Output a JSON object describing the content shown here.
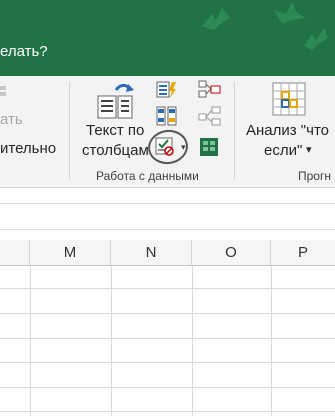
{
  "titlebar": {
    "tell_me_text": "елать?",
    "bg_color": "#217346"
  },
  "ribbon": {
    "left_partial_dim": "ать",
    "left_partial_text": "ительно",
    "text_to_columns": {
      "line1": "Текст по",
      "line2": "столбцам",
      "icon": "text-to-columns-icon"
    },
    "small_buttons": [
      {
        "name": "flash-fill",
        "icon": "flash-fill-icon"
      },
      {
        "name": "remove-duplicates",
        "icon": "remove-duplicates-icon"
      },
      {
        "name": "data-validation",
        "icon": "data-validation-icon"
      },
      {
        "name": "consolidate",
        "icon": "consolidate-icon"
      },
      {
        "name": "relationships",
        "icon": "relationships-icon"
      },
      {
        "name": "manage-data-model",
        "icon": "data-model-icon"
      }
    ],
    "data_tools_group_label": "Работа с данными",
    "what_if": {
      "line1": "Анализ \"что",
      "line2": "если\"",
      "arrow": "▾",
      "icon": "what-if-analysis-icon"
    },
    "forecast_group_label": "Прогн"
  },
  "sheet": {
    "columns": [
      "M",
      "N",
      "O",
      "P"
    ]
  }
}
